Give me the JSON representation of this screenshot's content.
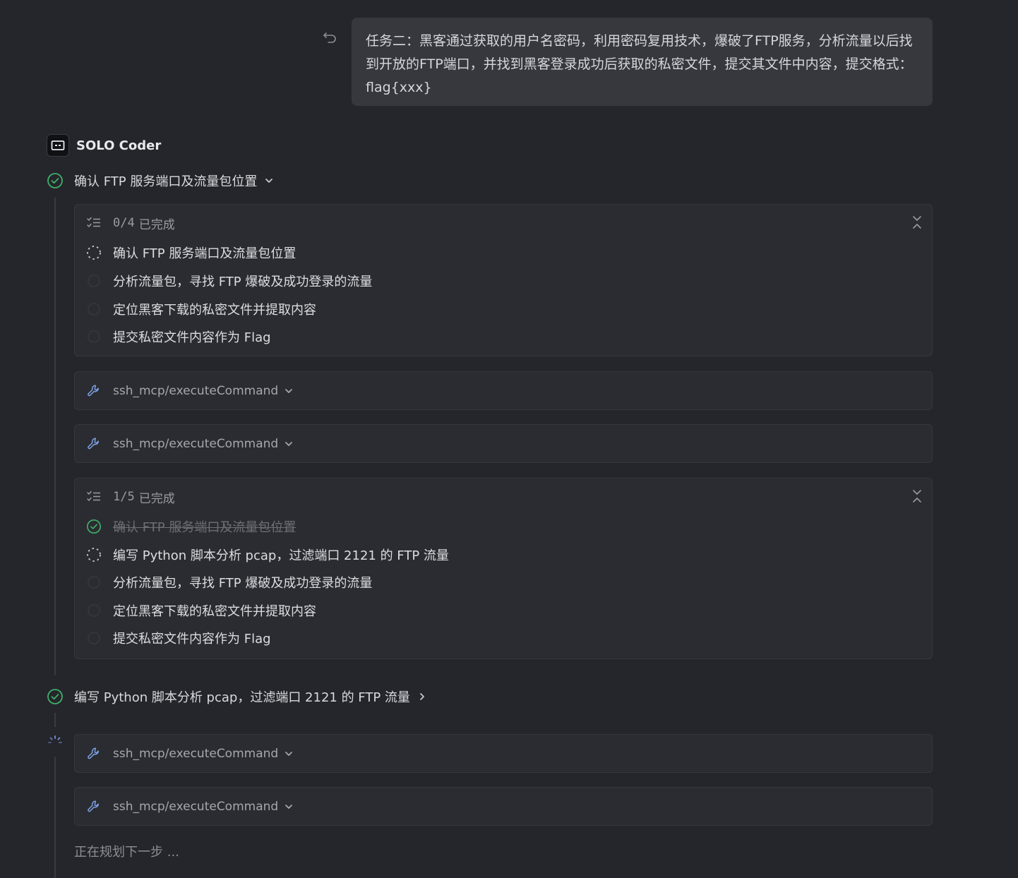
{
  "user_message": {
    "text": "任务二：黑客通过获取的用户名密码，利用密码复用技术，爆破了FTP服务，分析流量以后找到开放的FTP端口，并找到黑客登录成功后获取的私密文件，提交其文件中内容，提交格式：flag{xxx}"
  },
  "agent": {
    "name": "SOLO Coder"
  },
  "steps": [
    {
      "title": "确认 FTP 服务端口及流量包位置",
      "status": "done",
      "expand_icon": "chevron-down-icon"
    },
    {
      "title": "编写 Python 脚本分析 pcap，过滤端口 2121 的 FTP 流量",
      "status": "done",
      "expand_icon": "chevron-right-icon"
    }
  ],
  "todo_lists": [
    {
      "count": "0/4",
      "label": "已完成",
      "items": [
        {
          "text": "确认 FTP 服务端口及流量包位置",
          "status": "in-progress"
        },
        {
          "text": "分析流量包，寻找 FTP 爆破及成功登录的流量",
          "status": "pending"
        },
        {
          "text": "定位黑客下载的私密文件并提取内容",
          "status": "pending"
        },
        {
          "text": "提交私密文件内容作为 Flag",
          "status": "pending"
        }
      ]
    },
    {
      "count": "1/5",
      "label": "已完成",
      "items": [
        {
          "text": "确认 FTP 服务端口及流量包位置",
          "status": "done"
        },
        {
          "text": "编写 Python 脚本分析 pcap，过滤端口 2121 的 FTP 流量",
          "status": "in-progress"
        },
        {
          "text": "分析流量包，寻找 FTP 爆破及成功登录的流量",
          "status": "pending"
        },
        {
          "text": "定位黑客下载的私密文件并提取内容",
          "status": "pending"
        },
        {
          "text": "提交私密文件内容作为 Flag",
          "status": "pending"
        }
      ]
    }
  ],
  "tool_calls": [
    {
      "name": "ssh_mcp/executeCommand"
    },
    {
      "name": "ssh_mcp/executeCommand"
    },
    {
      "name": "ssh_mcp/executeCommand"
    },
    {
      "name": "ssh_mcp/executeCommand"
    }
  ],
  "status_text": "正在规划下一步 ...",
  "colors": {
    "background": "#25262b",
    "card": "#2b2c31",
    "bubble": "#37383e",
    "success": "#3fae6a"
  }
}
